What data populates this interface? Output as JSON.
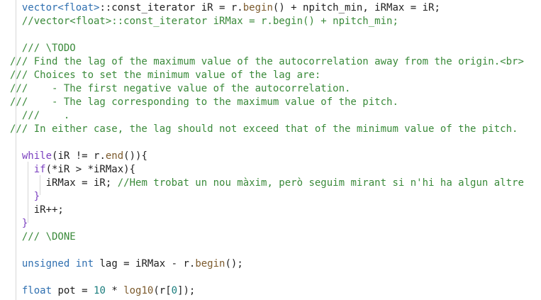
{
  "code_lines": [
    {
      "indent": 2,
      "segments": [
        {
          "cls": "t-type",
          "text": "vector<float>"
        },
        {
          "cls": "t-plain",
          "text": "::const_iterator iR = r."
        },
        {
          "cls": "t-fn",
          "text": "begin"
        },
        {
          "cls": "t-plain",
          "text": "() + npitch_min, iRMax = iR;"
        }
      ]
    },
    {
      "indent": 2,
      "segments": [
        {
          "cls": "t-com",
          "text": "//vector<float>::const_iterator iRMax = r.begin() + npitch_min;"
        }
      ]
    },
    {
      "indent": 0,
      "segments": []
    },
    {
      "indent": 2,
      "segments": [
        {
          "cls": "t-com",
          "text": "/// \\TODO"
        }
      ]
    },
    {
      "indent": 0,
      "segments": [
        {
          "cls": "t-com",
          "text": "/// Find the lag of the maximum value of the autocorrelation away from the origin.<br>"
        }
      ]
    },
    {
      "indent": 0,
      "segments": [
        {
          "cls": "t-com",
          "text": "/// Choices to set the minimum value of the lag are:"
        }
      ]
    },
    {
      "indent": 0,
      "segments": [
        {
          "cls": "t-com",
          "text": "///    - The first negative value of the autocorrelation."
        }
      ]
    },
    {
      "indent": 0,
      "segments": [
        {
          "cls": "t-com",
          "text": "///    - The lag corresponding to the maximum value of the pitch."
        }
      ]
    },
    {
      "indent": 2,
      "segments": [
        {
          "cls": "t-com",
          "text": "///    ."
        }
      ]
    },
    {
      "indent": 0,
      "segments": [
        {
          "cls": "t-com",
          "text": "/// In either case, the lag should not exceed that of the minimum value of the pitch."
        }
      ]
    },
    {
      "indent": 0,
      "segments": []
    },
    {
      "indent": 2,
      "segments": [
        {
          "cls": "t-kw",
          "text": "while"
        },
        {
          "cls": "t-plain",
          "text": "(iR != r."
        },
        {
          "cls": "t-fn",
          "text": "end"
        },
        {
          "cls": "t-plain",
          "text": "()){"
        }
      ]
    },
    {
      "indent": 4,
      "segments": [
        {
          "cls": "t-kw",
          "text": "if"
        },
        {
          "cls": "t-plain",
          "text": "(*iR > *iRMax){"
        }
      ]
    },
    {
      "indent": 6,
      "segments": [
        {
          "cls": "t-plain",
          "text": "iRMax = iR; "
        },
        {
          "cls": "t-com",
          "text": "//Hem trobat un nou màxim, però seguim mirant si n'hi ha algun altre"
        }
      ]
    },
    {
      "indent": 4,
      "segments": [
        {
          "cls": "t-kw",
          "text": "}"
        }
      ]
    },
    {
      "indent": 4,
      "segments": [
        {
          "cls": "t-plain",
          "text": "iR++;"
        }
      ]
    },
    {
      "indent": 2,
      "segments": [
        {
          "cls": "t-kw",
          "text": "}"
        }
      ]
    },
    {
      "indent": 2,
      "segments": [
        {
          "cls": "t-com",
          "text": "/// \\DONE"
        }
      ]
    },
    {
      "indent": 0,
      "segments": []
    },
    {
      "indent": 2,
      "segments": [
        {
          "cls": "t-type",
          "text": "unsigned"
        },
        {
          "cls": "t-plain",
          "text": " "
        },
        {
          "cls": "t-type",
          "text": "int"
        },
        {
          "cls": "t-plain",
          "text": " lag = iRMax - r."
        },
        {
          "cls": "t-fn",
          "text": "begin"
        },
        {
          "cls": "t-plain",
          "text": "();"
        }
      ]
    },
    {
      "indent": 0,
      "segments": []
    },
    {
      "indent": 2,
      "segments": [
        {
          "cls": "t-type",
          "text": "float"
        },
        {
          "cls": "t-plain",
          "text": " pot = "
        },
        {
          "cls": "t-num",
          "text": "10"
        },
        {
          "cls": "t-plain",
          "text": " * "
        },
        {
          "cls": "t-fn",
          "text": "log10"
        },
        {
          "cls": "t-plain",
          "text": "(r["
        },
        {
          "cls": "t-num",
          "text": "0"
        },
        {
          "cls": "t-plain",
          "text": "]);"
        }
      ]
    }
  ]
}
